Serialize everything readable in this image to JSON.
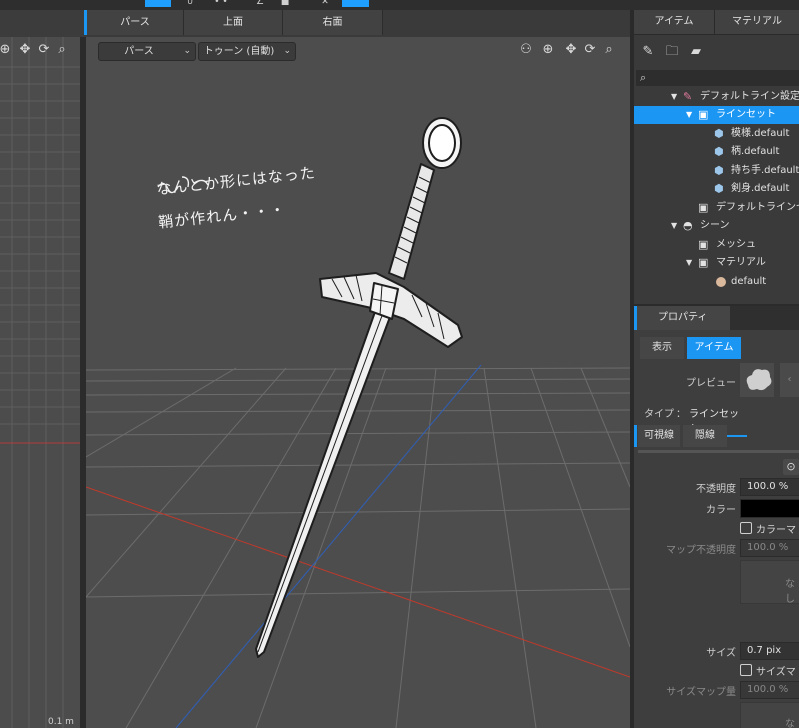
{
  "view_tabs": [
    "パース",
    "上面",
    "右面"
  ],
  "viewport": {
    "camera_mode": "パース",
    "render_mode": "トゥーン (自動)",
    "note_line1": "なんとか形にはなった",
    "note_line2": "鞘が作れん・・・"
  },
  "left_viewport": {
    "scale_label": "0.1 m"
  },
  "right_tabs": [
    "アイテム",
    "マテリアル"
  ],
  "tree": {
    "items": [
      {
        "label": "デフォルトライン設定",
        "icon": "pen-icon"
      },
      {
        "label": "ラインセット",
        "icon": "folder-icon",
        "selected": true
      },
      {
        "label": "模様.default",
        "icon": "cube-icon"
      },
      {
        "label": "柄.default",
        "icon": "cube-icon"
      },
      {
        "label": "持ち手.default",
        "icon": "cube-icon"
      },
      {
        "label": "剣身.default",
        "icon": "cube-icon"
      },
      {
        "label": "デフォルトラインセ",
        "icon": "folder-icon"
      },
      {
        "label": "シーン",
        "icon": "scene-icon"
      },
      {
        "label": "メッシュ",
        "icon": "mesh-folder-icon"
      },
      {
        "label": "マテリアル",
        "icon": "material-folder-icon"
      },
      {
        "label": "default",
        "icon": "material-ball-icon",
        "color": "#d9b89c"
      }
    ]
  },
  "properties": {
    "title": "プロパティ",
    "tabs": [
      "表示",
      "アイテム"
    ],
    "preview_label": "プレビュー",
    "type_label": "タイプ",
    "type_sep": "：",
    "type_value": "ラインセット",
    "sub_tabs": [
      "可視線",
      "隠線"
    ],
    "opacity_label": "不透明度",
    "opacity_value": "100.0 %",
    "color_label": "カラー",
    "color_value": "#000000",
    "color_map_label": "カラーマッ",
    "map_opacity_label": "マップ不透明度",
    "map_opacity_value": "100.0 %",
    "map_none": "なし",
    "size_label": "サイズ",
    "size_value": "0.7 pix",
    "size_map_label": "サイズマッ",
    "size_map_amount_label": "サイズマップ量",
    "size_map_amount_value": "100.0 %",
    "size_map_none": "なし"
  },
  "colors": {
    "accent": "#1c96f3",
    "sword_outline": "#1e1e1e",
    "sword_fill": "#f0f0f0"
  }
}
